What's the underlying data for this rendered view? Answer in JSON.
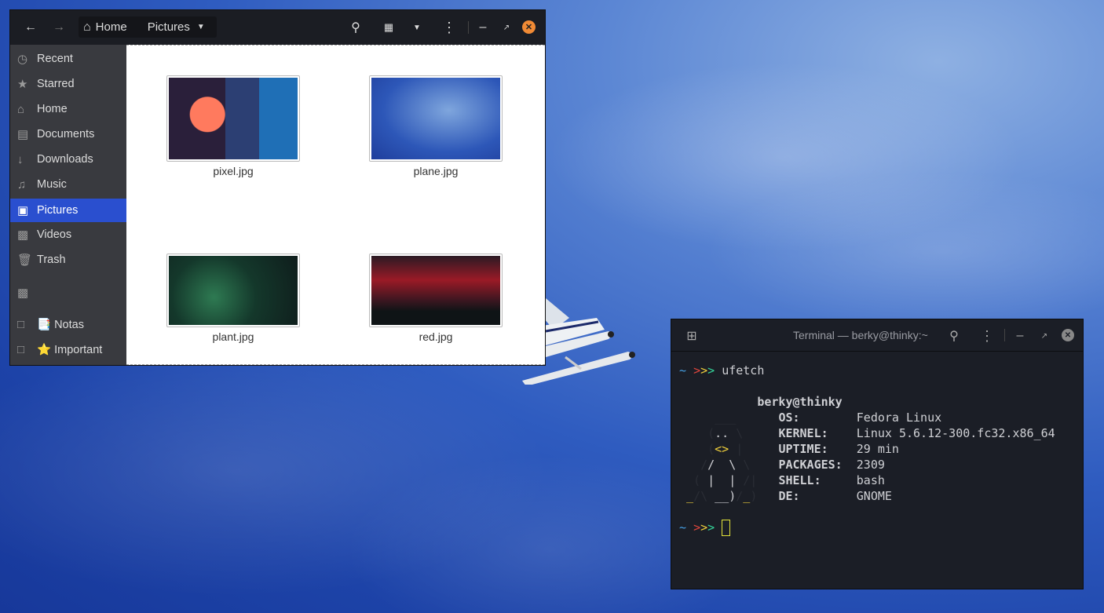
{
  "files_window": {
    "breadcrumbs": [
      {
        "label": "Home",
        "icon": "home-icon"
      },
      {
        "label": "Pictures"
      }
    ],
    "sidebar": [
      {
        "label": "Recent",
        "icon": "clock-icon"
      },
      {
        "label": "Starred",
        "icon": "star-icon"
      },
      {
        "label": "Home",
        "icon": "home-icon"
      },
      {
        "label": "Documents",
        "icon": "document-icon"
      },
      {
        "label": "Downloads",
        "icon": "download-icon"
      },
      {
        "label": "Music",
        "icon": "music-icon"
      },
      {
        "label": "Pictures",
        "icon": "camera-icon",
        "selected": true
      },
      {
        "label": "Videos",
        "icon": "video-icon"
      },
      {
        "label": "Trash",
        "icon": "trash-icon"
      },
      {
        "label": "",
        "icon": "computer-icon"
      },
      {
        "label": "📑 Notas",
        "icon": "folder-icon"
      },
      {
        "label": "⭐ Important",
        "icon": "folder-icon"
      }
    ],
    "files": [
      {
        "name": "pixel.jpg"
      },
      {
        "name": "plane.jpg"
      },
      {
        "name": "plant.jpg"
      },
      {
        "name": "red.jpg"
      }
    ],
    "accent": "#2a4fcf",
    "close_color": "#f08a35"
  },
  "terminal": {
    "title": "Terminal — berky@thinky:~",
    "command": "ufetch",
    "prompt": ">>>",
    "user_host": "berky@thinky",
    "info": [
      {
        "key": "OS:",
        "value": "Fedora Linux"
      },
      {
        "key": "KERNEL:",
        "value": "Linux 5.6.12-300.fc32.x86_64"
      },
      {
        "key": "UPTIME:",
        "value": "29 min"
      },
      {
        "key": "PACKAGES:",
        "value": "2309"
      },
      {
        "key": "SHELL:",
        "value": "bash"
      },
      {
        "key": "DE:",
        "value": "GNOME"
      }
    ]
  }
}
